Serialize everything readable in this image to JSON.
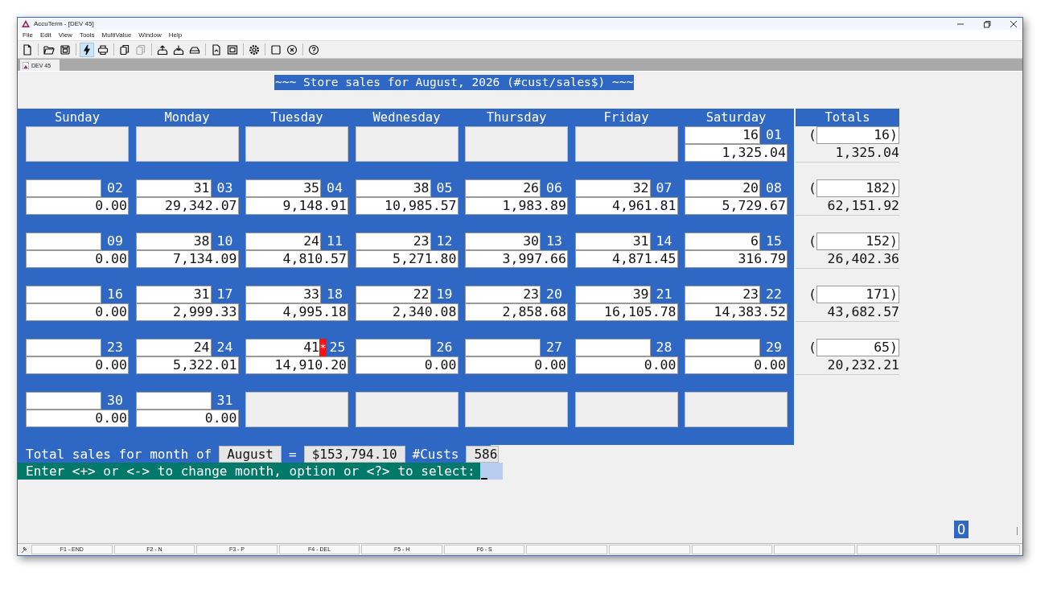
{
  "window": {
    "title": "AccuTerm - [DEV 45]"
  },
  "menu": [
    "File",
    "Edit",
    "View",
    "Tools",
    "MultiValue",
    "Window",
    "Help"
  ],
  "toolbar": [
    {
      "kind": "new",
      "active": false,
      "disabled": false
    },
    {
      "kind": "open",
      "active": false,
      "disabled": false
    },
    {
      "kind": "save",
      "active": false,
      "disabled": false
    },
    {
      "kind": "lightning",
      "active": true,
      "disabled": false
    },
    {
      "kind": "print",
      "active": false,
      "disabled": false
    },
    {
      "kind": "copy",
      "active": false,
      "disabled": false
    },
    {
      "kind": "paste",
      "active": false,
      "disabled": true
    },
    {
      "kind": "upload",
      "active": false,
      "disabled": false
    },
    {
      "kind": "download",
      "active": false,
      "disabled": false
    },
    {
      "kind": "drive",
      "active": false,
      "disabled": false
    },
    {
      "kind": "document",
      "active": false,
      "disabled": false
    },
    {
      "kind": "frame",
      "active": false,
      "disabled": false
    },
    {
      "kind": "settings",
      "active": false,
      "disabled": false
    },
    {
      "kind": "square",
      "active": false,
      "disabled": false
    },
    {
      "kind": "close",
      "active": false,
      "disabled": false
    },
    {
      "kind": "help",
      "active": false,
      "disabled": false
    }
  ],
  "tabs": [
    {
      "label": "DEV 45",
      "selected": true
    }
  ],
  "banner": "~~~ Store sales for August, 2026 (#cust/sales$) ~~~",
  "days": [
    "Sunday",
    "Monday",
    "Tuesday",
    "Wednesday",
    "Thursday",
    "Friday",
    "Saturday"
  ],
  "totals_header": "Totals",
  "weeks": [
    {
      "cells": [
        {
          "kind": "empty"
        },
        {
          "kind": "empty"
        },
        {
          "kind": "empty"
        },
        {
          "kind": "empty"
        },
        {
          "kind": "empty"
        },
        {
          "kind": "empty"
        },
        {
          "kind": "day",
          "count": "16",
          "day": "01",
          "sales": "1,325.04"
        }
      ],
      "total": {
        "paren": "(",
        "count": "16)",
        "sales": "1,325.04"
      }
    },
    {
      "cells": [
        {
          "kind": "day",
          "day": "02",
          "sales": "0.00"
        },
        {
          "kind": "day",
          "count": "31",
          "day": "03",
          "sales": "29,342.07"
        },
        {
          "kind": "day",
          "count": "35",
          "day": "04",
          "sales": "9,148.91"
        },
        {
          "kind": "day",
          "count": "38",
          "day": "05",
          "sales": "10,985.57"
        },
        {
          "kind": "day",
          "count": "26",
          "day": "06",
          "sales": "1,983.89"
        },
        {
          "kind": "day",
          "count": "32",
          "day": "07",
          "sales": "4,961.81"
        },
        {
          "kind": "day",
          "count": "20",
          "day": "08",
          "sales": "5,729.67"
        }
      ],
      "total": {
        "paren": "(",
        "count": "182)",
        "sales": "62,151.92"
      }
    },
    {
      "cells": [
        {
          "kind": "day",
          "day": "09",
          "sales": "0.00"
        },
        {
          "kind": "day",
          "count": "38",
          "day": "10",
          "sales": "7,134.09"
        },
        {
          "kind": "day",
          "count": "24",
          "day": "11",
          "sales": "4,810.57"
        },
        {
          "kind": "day",
          "count": "23",
          "day": "12",
          "sales": "5,271.80"
        },
        {
          "kind": "day",
          "count": "30",
          "day": "13",
          "sales": "3,997.66"
        },
        {
          "kind": "day",
          "count": "31",
          "day": "14",
          "sales": "4,871.45"
        },
        {
          "kind": "day",
          "count": "6",
          "day": "15",
          "sales": "316.79"
        }
      ],
      "total": {
        "paren": "(",
        "count": "152)",
        "sales": "26,402.36"
      }
    },
    {
      "cells": [
        {
          "kind": "day",
          "day": "16",
          "sales": "0.00"
        },
        {
          "kind": "day",
          "count": "31",
          "day": "17",
          "sales": "2,999.33"
        },
        {
          "kind": "day",
          "count": "33",
          "day": "18",
          "sales": "4,995.18"
        },
        {
          "kind": "day",
          "count": "22",
          "day": "19",
          "sales": "2,340.08"
        },
        {
          "kind": "day",
          "count": "23",
          "day": "20",
          "sales": "2,858.68"
        },
        {
          "kind": "day",
          "count": "39",
          "day": "21",
          "sales": "16,105.78"
        },
        {
          "kind": "day",
          "count": "23",
          "day": "22",
          "sales": "14,383.52"
        }
      ],
      "total": {
        "paren": "(",
        "count": "171)",
        "sales": "43,682.57"
      }
    },
    {
      "cells": [
        {
          "kind": "day",
          "day": "23",
          "sales": "0.00"
        },
        {
          "kind": "day",
          "count": "24",
          "day": "24",
          "sales": "5,322.01"
        },
        {
          "kind": "day",
          "count": "41",
          "flag": "*",
          "day": "25",
          "sales": "14,910.20"
        },
        {
          "kind": "day",
          "day": "26",
          "sales": "0.00"
        },
        {
          "kind": "day",
          "day": "27",
          "sales": "0.00"
        },
        {
          "kind": "day",
          "day": "28",
          "sales": "0.00"
        },
        {
          "kind": "day",
          "day": "29",
          "sales": "0.00"
        }
      ],
      "total": {
        "paren": "(",
        "count": "65)",
        "sales": "20,232.21"
      }
    },
    {
      "cells": [
        {
          "kind": "day",
          "day": "30",
          "sales": "0.00"
        },
        {
          "kind": "day",
          "day": "31",
          "sales": "0.00"
        },
        {
          "kind": "empty"
        },
        {
          "kind": "empty"
        },
        {
          "kind": "empty"
        },
        {
          "kind": "empty"
        },
        {
          "kind": "empty"
        }
      ]
    }
  ],
  "summary": {
    "label": "Total sales for month of",
    "month": "August",
    "equals": "=",
    "amount": "$153,794.10",
    "custs_label": "#Custs",
    "custs": "586"
  },
  "prompt": {
    "text": "Enter <+> or <-> to change month, option or <?> to select:"
  },
  "corner_mark": "O",
  "function_keys": [
    "F1 - END",
    "F2 - N",
    "F3 - P",
    "F4 - DEL",
    "F5 - H",
    "F6 - S"
  ]
}
